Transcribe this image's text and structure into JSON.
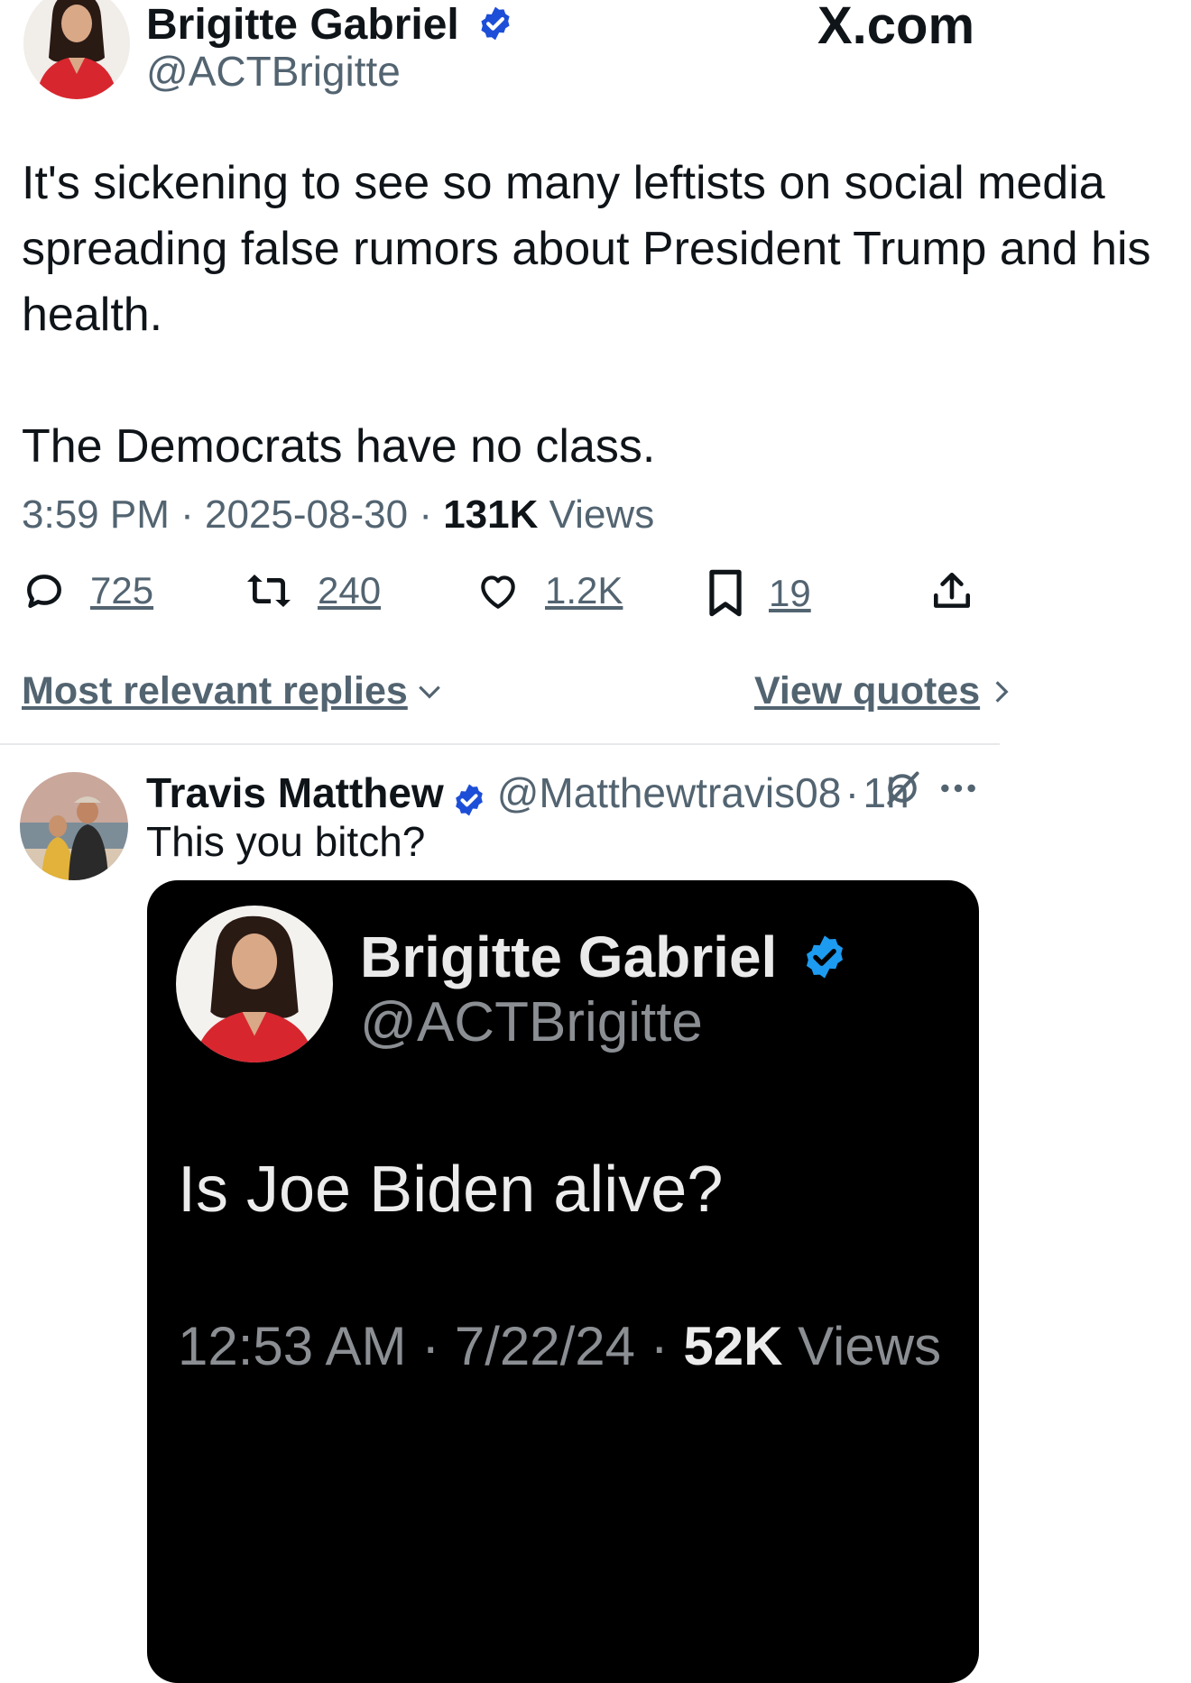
{
  "watermark": "X.com",
  "colors": {
    "verified": "#1d4ed8",
    "verified_dark": "#1d9bf0",
    "text": "#0f1419",
    "muted": "#536471"
  },
  "tweet": {
    "author_name": "Brigitte Gabriel",
    "author_handle": "@ACTBrigitte",
    "text": "It's sickening to see so many leftists on social media spreading false rumors about President Trump and his health.\n\nThe Democrats have no class.",
    "time": "3:59 PM",
    "date": "2025-08-30",
    "views_count": "131K",
    "views_label": "Views",
    "sep": "·",
    "actions": {
      "replies": {
        "icon": "reply-icon",
        "count": "725"
      },
      "reposts": {
        "icon": "repost-icon",
        "count": "240"
      },
      "likes": {
        "icon": "like-icon",
        "count": "1.2K"
      },
      "bookmarks": {
        "icon": "bookmark-icon",
        "count": "19"
      },
      "share": {
        "icon": "share-icon"
      }
    }
  },
  "replies_bar": {
    "sort_label": "Most relevant replies",
    "quotes_label": "View quotes"
  },
  "reply": {
    "author_name": "Travis Matthew",
    "author_handle": "@Matthewtravis08",
    "time": "1h",
    "sep": "·",
    "text": "This you bitch?",
    "quoted": {
      "author_name": "Brigitte Gabriel",
      "author_handle": "@ACTBrigitte",
      "text": "Is Joe Biden alive?",
      "time": "12:53 AM",
      "date": "7/22/24",
      "views_count": "52K",
      "views_label": "Views",
      "sep": "·"
    }
  }
}
